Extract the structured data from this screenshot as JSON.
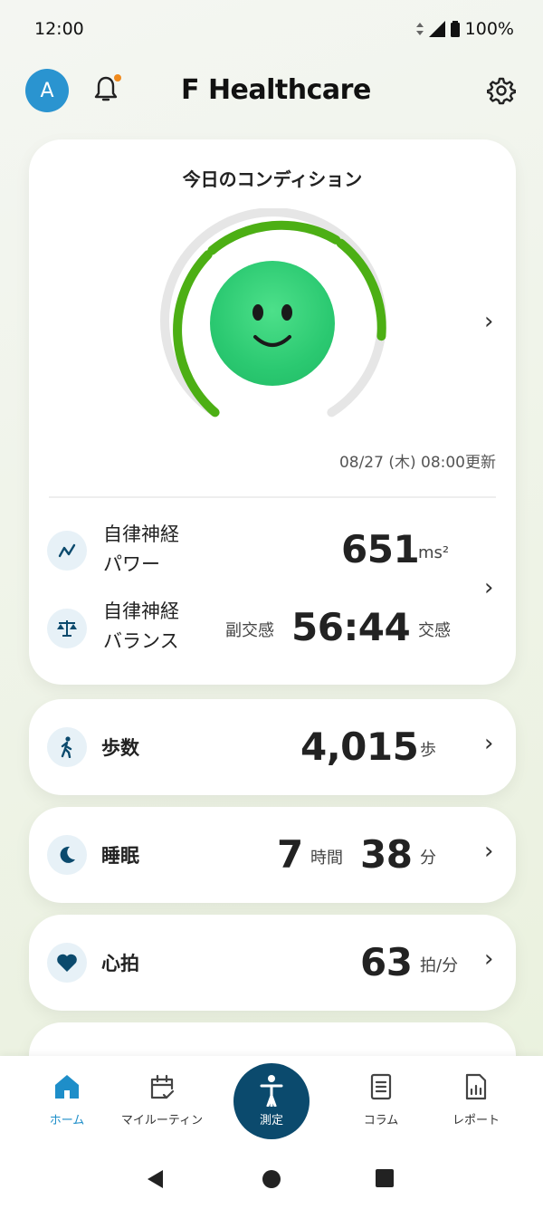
{
  "status": {
    "time": "12:00",
    "battery": "100%"
  },
  "header": {
    "avatar_letter": "A",
    "brand": "F Healthcare"
  },
  "condition": {
    "title": "今日のコンディション",
    "updated": "08/27 (木) 08:00更新",
    "gauge_level": 0.75
  },
  "autonomic": {
    "power_label_1": "自律神経",
    "power_label_2": "パワー",
    "power_value": "651",
    "power_unit": "ms²",
    "balance_label_1": "自律神経",
    "balance_label_2": "バランス",
    "parasym_label": "副交感",
    "balance_value": "56:44",
    "sym_label": "交感"
  },
  "steps": {
    "label": "歩数",
    "value": "4,015",
    "unit": "歩"
  },
  "sleep": {
    "label": "睡眠",
    "hours": "7",
    "hours_unit": "時間",
    "minutes": "38",
    "minutes_unit": "分"
  },
  "heart": {
    "label": "心拍",
    "value": "63",
    "unit": "拍/分"
  },
  "nav": {
    "home": "ホーム",
    "routine": "マイルーティン",
    "measure": "測定",
    "column": "コラム",
    "report": "レポート"
  },
  "colors": {
    "accent": "#1e8ec9",
    "gauge": "#4caf14",
    "navy": "#0b4a6d"
  }
}
